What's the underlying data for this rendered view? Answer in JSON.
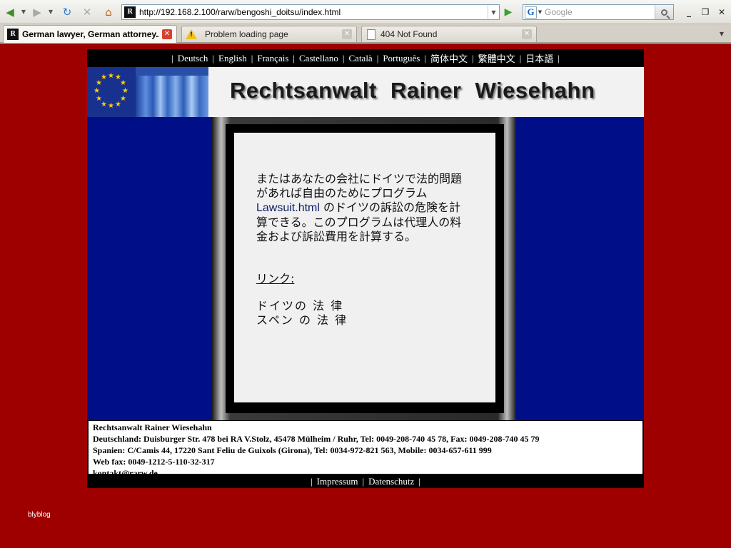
{
  "browser": {
    "url": "http://192.168.2.100/rarw/bengoshi_doitsu/index.html",
    "search_placeholder": "Google",
    "tabs": [
      {
        "title": "German lawyer, German attorney...",
        "icon": "site-favicon-icon",
        "active": true
      },
      {
        "title": "Problem loading page",
        "icon": "warning-icon",
        "active": false
      },
      {
        "title": "404 Not Found",
        "icon": "document-icon",
        "active": false
      }
    ],
    "window_controls": {
      "minimize": "_",
      "restore": "❐",
      "close": "✕"
    }
  },
  "site": {
    "languages": [
      "Deutsch",
      "English",
      "Français",
      "Castellano",
      "Català",
      "Português",
      "简体中文",
      "繁體中文",
      "日本語"
    ],
    "banner_title": "Rechtsanwalt  Rainer  Wiesehahn",
    "content": {
      "intro_before_link": "またはあなたの会社にドイツで法的問題があれば自由のためにプログラム ",
      "link_text": "Lawsuit.html",
      "intro_after_link": " のドイツの訴訟の危険を計算できる。このプログラムは代理人の料金および訴訟費用を計算する。",
      "links_heading": "リンク:",
      "links": [
        "ドイツの 法 律",
        "スペン の 法 律"
      ]
    },
    "footer": {
      "name": "Rechtsanwalt Rainer Wiesehahn",
      "germany": "Deutschland: Duisburger Str. 478 bei RA V.Stolz, 45478 Mülheim / Ruhr, Tel: 0049-208-740 45 78, Fax: 0049-208-740 45 79",
      "spain": "Spanien: C/Camis 44, 17220 Sant Feliu de Guixols (Girona), Tel: 0034-972-821 563, Mobile: 0034-657-611 999",
      "webfax": "Web fax: 0049-1212-5-110-32-317",
      "email": "kontakt@rarw.de"
    },
    "bottom_links": [
      "Impressum",
      "Datenschutz"
    ]
  },
  "watermark": "blyblog",
  "colors": {
    "page_background": "#9e0000",
    "main_blue": "#000f88",
    "bar_black": "#000000"
  }
}
